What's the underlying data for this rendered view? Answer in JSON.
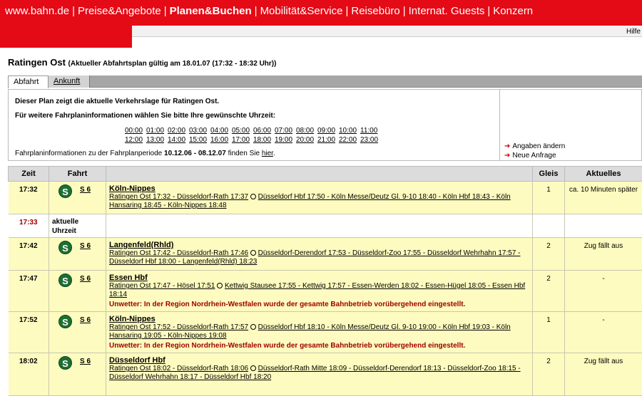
{
  "topnav": {
    "items": [
      "www.bahn.de",
      "Preise&Angebote",
      "Planen&Buchen",
      "Mobilität&Service",
      "Reisebüro",
      "Internat. Guests",
      "Konzern"
    ],
    "active": "Planen&Buchen"
  },
  "help_label": "Hilfe",
  "title": {
    "station": "Ratingen Ost",
    "subtitle": "(Aktueller Abfahrtsplan gültig am 18.01.07 (17:32 - 18:32 Uhr))"
  },
  "tabs": {
    "abfahrt": "Abfahrt",
    "ankunft": "Ankunft"
  },
  "info": {
    "line1": "Dieser Plan zeigt die aktuelle Verkehrslage für Ratingen Ost.",
    "line2": "Für weitere Fahrplaninformationen wählen Sie bitte Ihre gewünschte Uhrzeit:",
    "times_row1": [
      "00:00",
      "01:00",
      "02:00",
      "03:00",
      "04:00",
      "05:00",
      "06:00",
      "07:00",
      "08:00",
      "09:00",
      "10:00",
      "11:00"
    ],
    "times_row2": [
      "12:00",
      "13:00",
      "14:00",
      "15:00",
      "16:00",
      "17:00",
      "18:00",
      "19:00",
      "20:00",
      "21:00",
      "22:00",
      "23:00"
    ],
    "period_pre": "Fahrplaninformationen zu der Fahrplanperiode",
    "period": "10.12.06 - 08.12.07",
    "period_mid": "finden Sie",
    "period_link": "hier",
    "period_end": ".",
    "action_change": "Angaben ändern",
    "action_new": "Neue Anfrage"
  },
  "table": {
    "headers": {
      "zeit": "Zeit",
      "fahrt": "Fahrt",
      "route": "",
      "gleis": "Gleis",
      "aktuelles": "Aktuelles"
    },
    "icon_letter": "S",
    "current_label_1": "aktuelle",
    "current_label_2": "Uhrzeit",
    "current_time": "17:33",
    "rows": [
      {
        "zeit": "17:32",
        "line": "S 6",
        "dest": "Köln-Nippes",
        "route_a": "Ratingen Ost 17:32 - Düsseldorf-Rath 17:37",
        "route_b": "Düsseldorf Hbf 17:50 - Köln Messe/Deutz Gl. 9-10 18:40 - Köln Hbf 18:43 - Köln Hansaring 18:45 - Köln-Nippes 18:48",
        "warning": "",
        "gleis": "1",
        "aktuell": "ca. 10 Minuten später"
      },
      {
        "zeit": "17:42",
        "line": "S 6",
        "dest": "Langenfeld(Rhld)",
        "route_a": "Ratingen Ost 17:42 - Düsseldorf-Rath 17:46",
        "route_b": "Düsseldorf-Derendorf 17:53 - Düsseldorf-Zoo 17:55 - Düsseldorf Wehrhahn 17:57 - Düsseldorf Hbf 18:00 - Langenfeld(Rhld) 18:23",
        "warning": "",
        "gleis": "2",
        "aktuell": "Zug fällt aus"
      },
      {
        "zeit": "17:47",
        "line": "S 6",
        "dest": "Essen Hbf",
        "route_a": "Ratingen Ost 17:47 - Hösel 17:51",
        "route_b": "Kettwig Stausee 17:55 - Kettwig 17:57 - Essen-Werden 18:02 - Essen-Hügel 18:05 - Essen Hbf 18:14",
        "warning": "Unwetter: In der Region Nordrhein-Westfalen wurde der gesamte Bahnbetrieb vorübergehend eingestellt.",
        "gleis": "2",
        "aktuell": "-"
      },
      {
        "zeit": "17:52",
        "line": "S 6",
        "dest": "Köln-Nippes",
        "route_a": "Ratingen Ost 17:52 - Düsseldorf-Rath 17:57",
        "route_b": "Düsseldorf Hbf 18:10 - Köln Messe/Deutz Gl. 9-10 19:00 - Köln Hbf 19:03 - Köln Hansaring 19:05 - Köln-Nippes 19:08",
        "warning": "Unwetter: In der Region Nordrhein-Westfalen wurde der gesamte Bahnbetrieb vorübergehend eingestellt.",
        "gleis": "1",
        "aktuell": "-"
      },
      {
        "zeit": "18:02",
        "line": "S 6",
        "dest": "Düsseldorf Hbf",
        "route_a": "Ratingen Ost 18:02 - Düsseldorf-Rath 18:06",
        "route_b": "Düsseldorf-Rath Mitte 18:09 - Düsseldorf-Derendorf 18:13 - Düsseldorf-Zoo 18:15 - Düsseldorf Wehrhahn 18:17 - Düsseldorf Hbf 18:20",
        "warning": "",
        "gleis": "2",
        "aktuell": "Zug fällt aus"
      }
    ]
  },
  "colors": {
    "brand_red": "#e40a16",
    "row_yellow": "#fdfbbf",
    "warning_red": "#a00000",
    "sbahn_green": "#1e6e34"
  }
}
